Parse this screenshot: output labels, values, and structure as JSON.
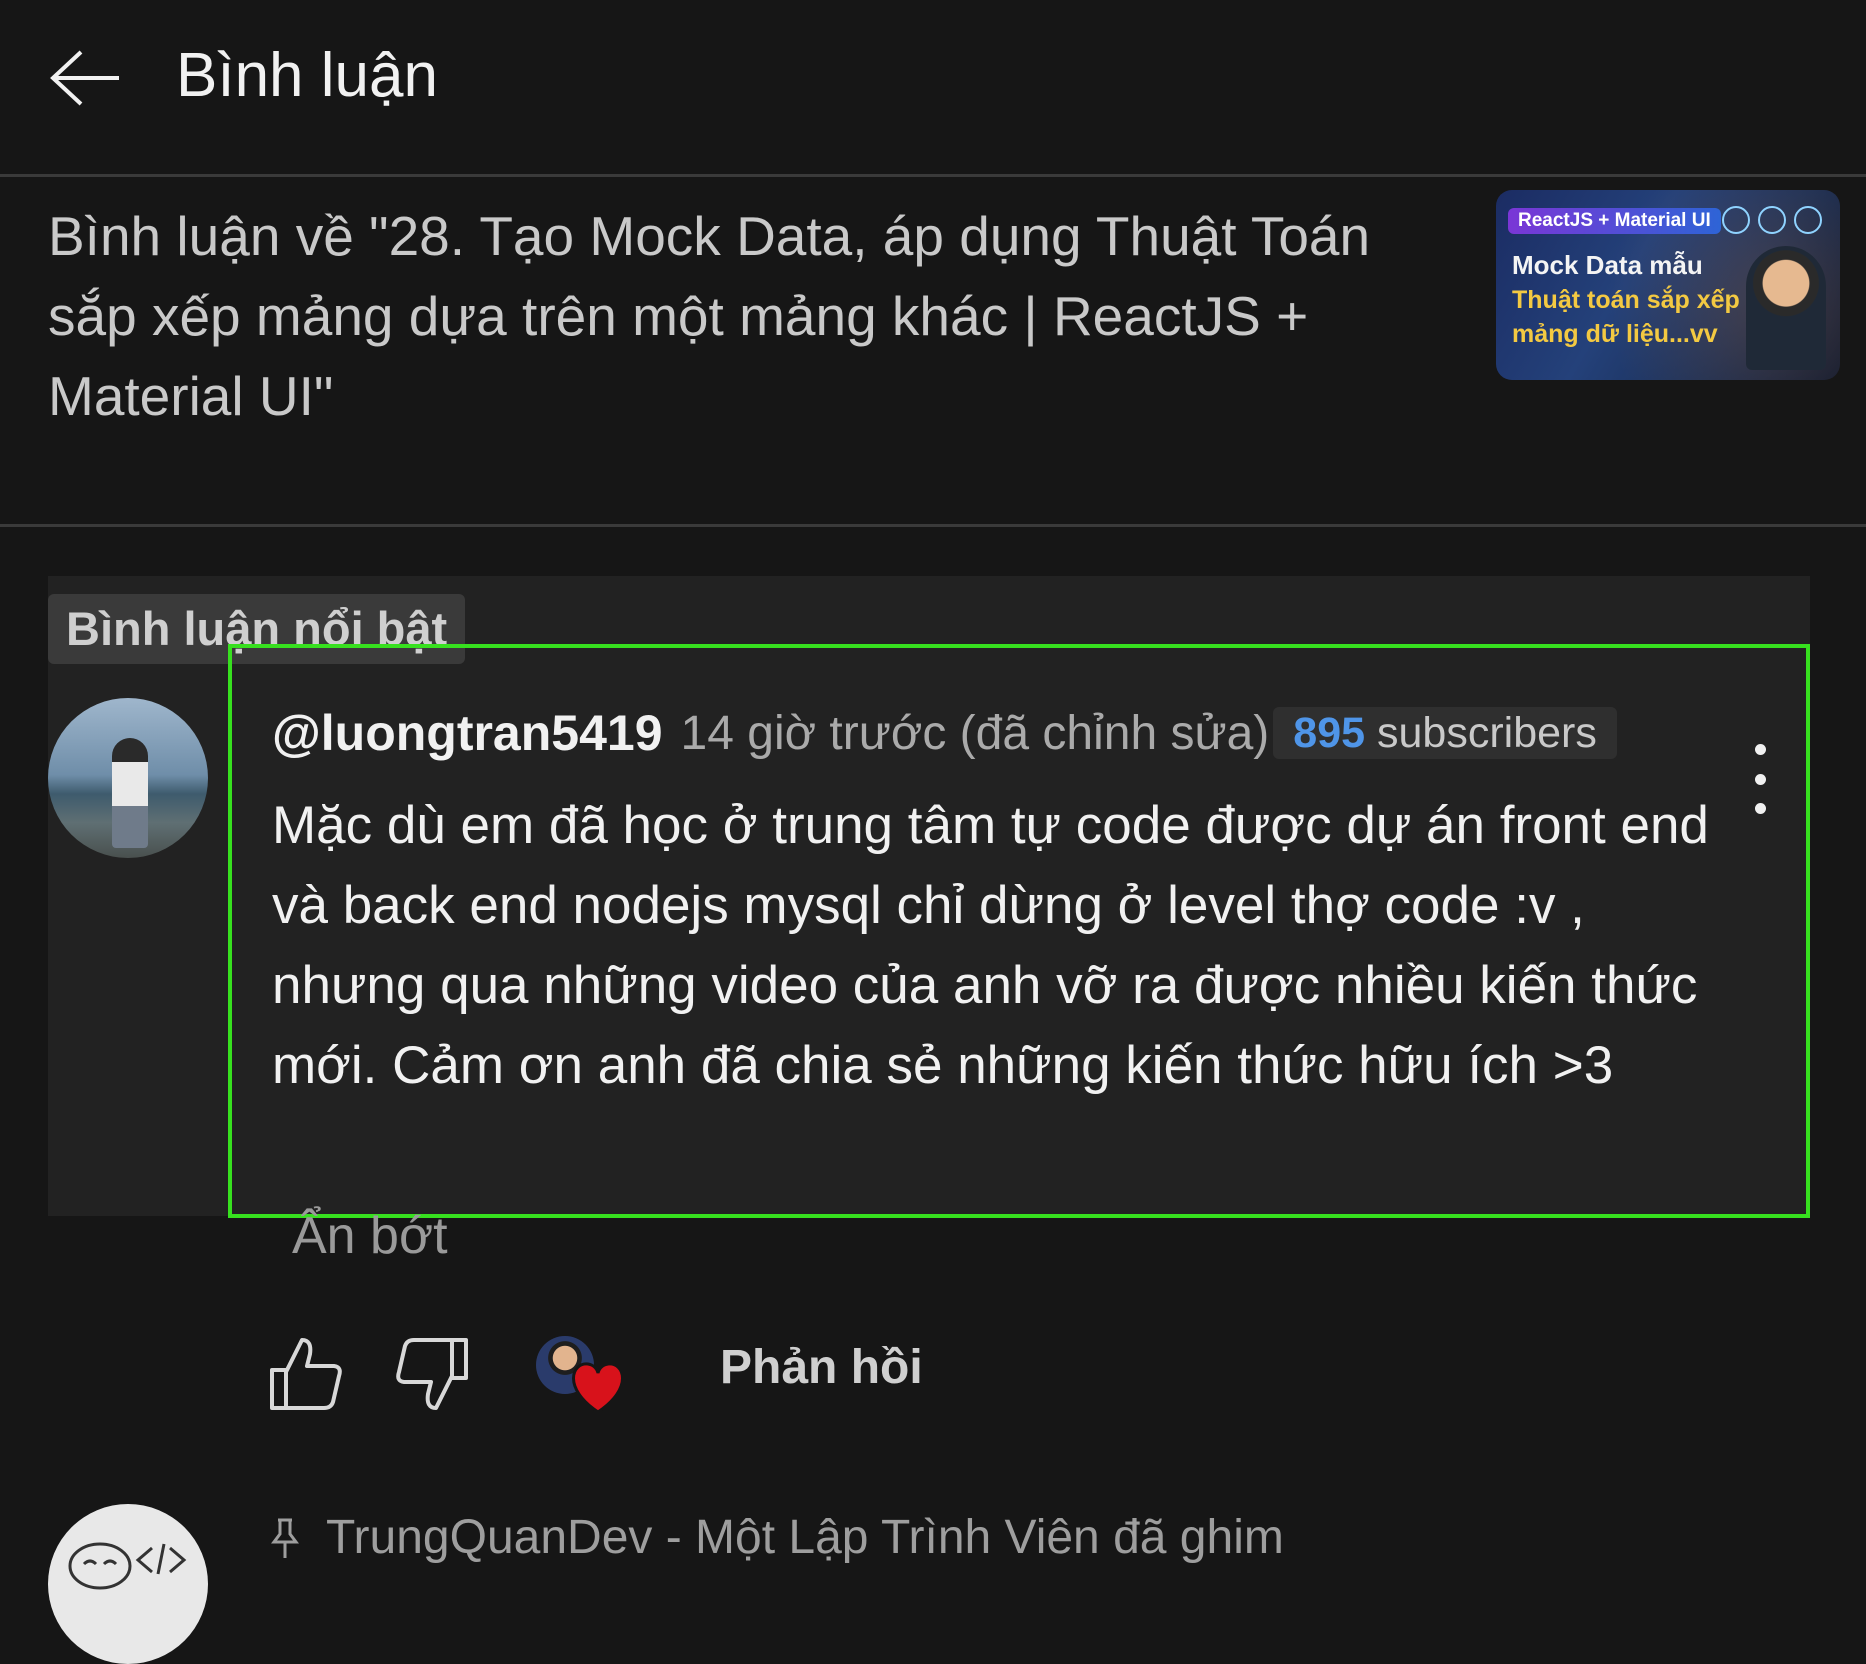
{
  "header": {
    "title": "Bình luận"
  },
  "video": {
    "context_title": "Bình luận về \"28. Tạo Mock Data, áp dụng Thuật Toán sắp xếp mảng dựa trên một mảng khác | ReactJS + Material UI\"",
    "thumbnail": {
      "tag": "ReactJS + Material UI",
      "line1": "Mock Data mẫu",
      "line2": "Thuật toán sắp xếp",
      "line3": "mảng dữ liệu...vv"
    }
  },
  "featured": {
    "badge": "Bình luận nổi bật",
    "author": "@luongtran5419",
    "time": "14 giờ trước (đã chỉnh sửa)",
    "subscriber_count": "895",
    "subscriber_label": "subscribers",
    "text": "Mặc dù em đã học ở trung tâm tự code được dự án front end và back end nodejs mysql chỉ dừng ở level thợ code :v , nhưng qua những video của anh vỡ ra được nhiều kiến thức mới. Cảm ơn anh đã chia sẻ những kiến thức hữu ích >3",
    "show_less": "Ẩn bớt",
    "reply_label": "Phản hồi"
  },
  "next_comment": {
    "pinned_text": "TrungQuanDev - Một Lập Trình Viên đã ghim"
  },
  "colors": {
    "highlight": "#37e01f",
    "subscriber_accent": "#4f95e8",
    "heart": "#d8121b"
  },
  "icons": [
    "back-arrow-icon",
    "more-vert-icon",
    "thumb-up-icon",
    "thumb-down-icon",
    "heart-icon",
    "pin-icon"
  ]
}
